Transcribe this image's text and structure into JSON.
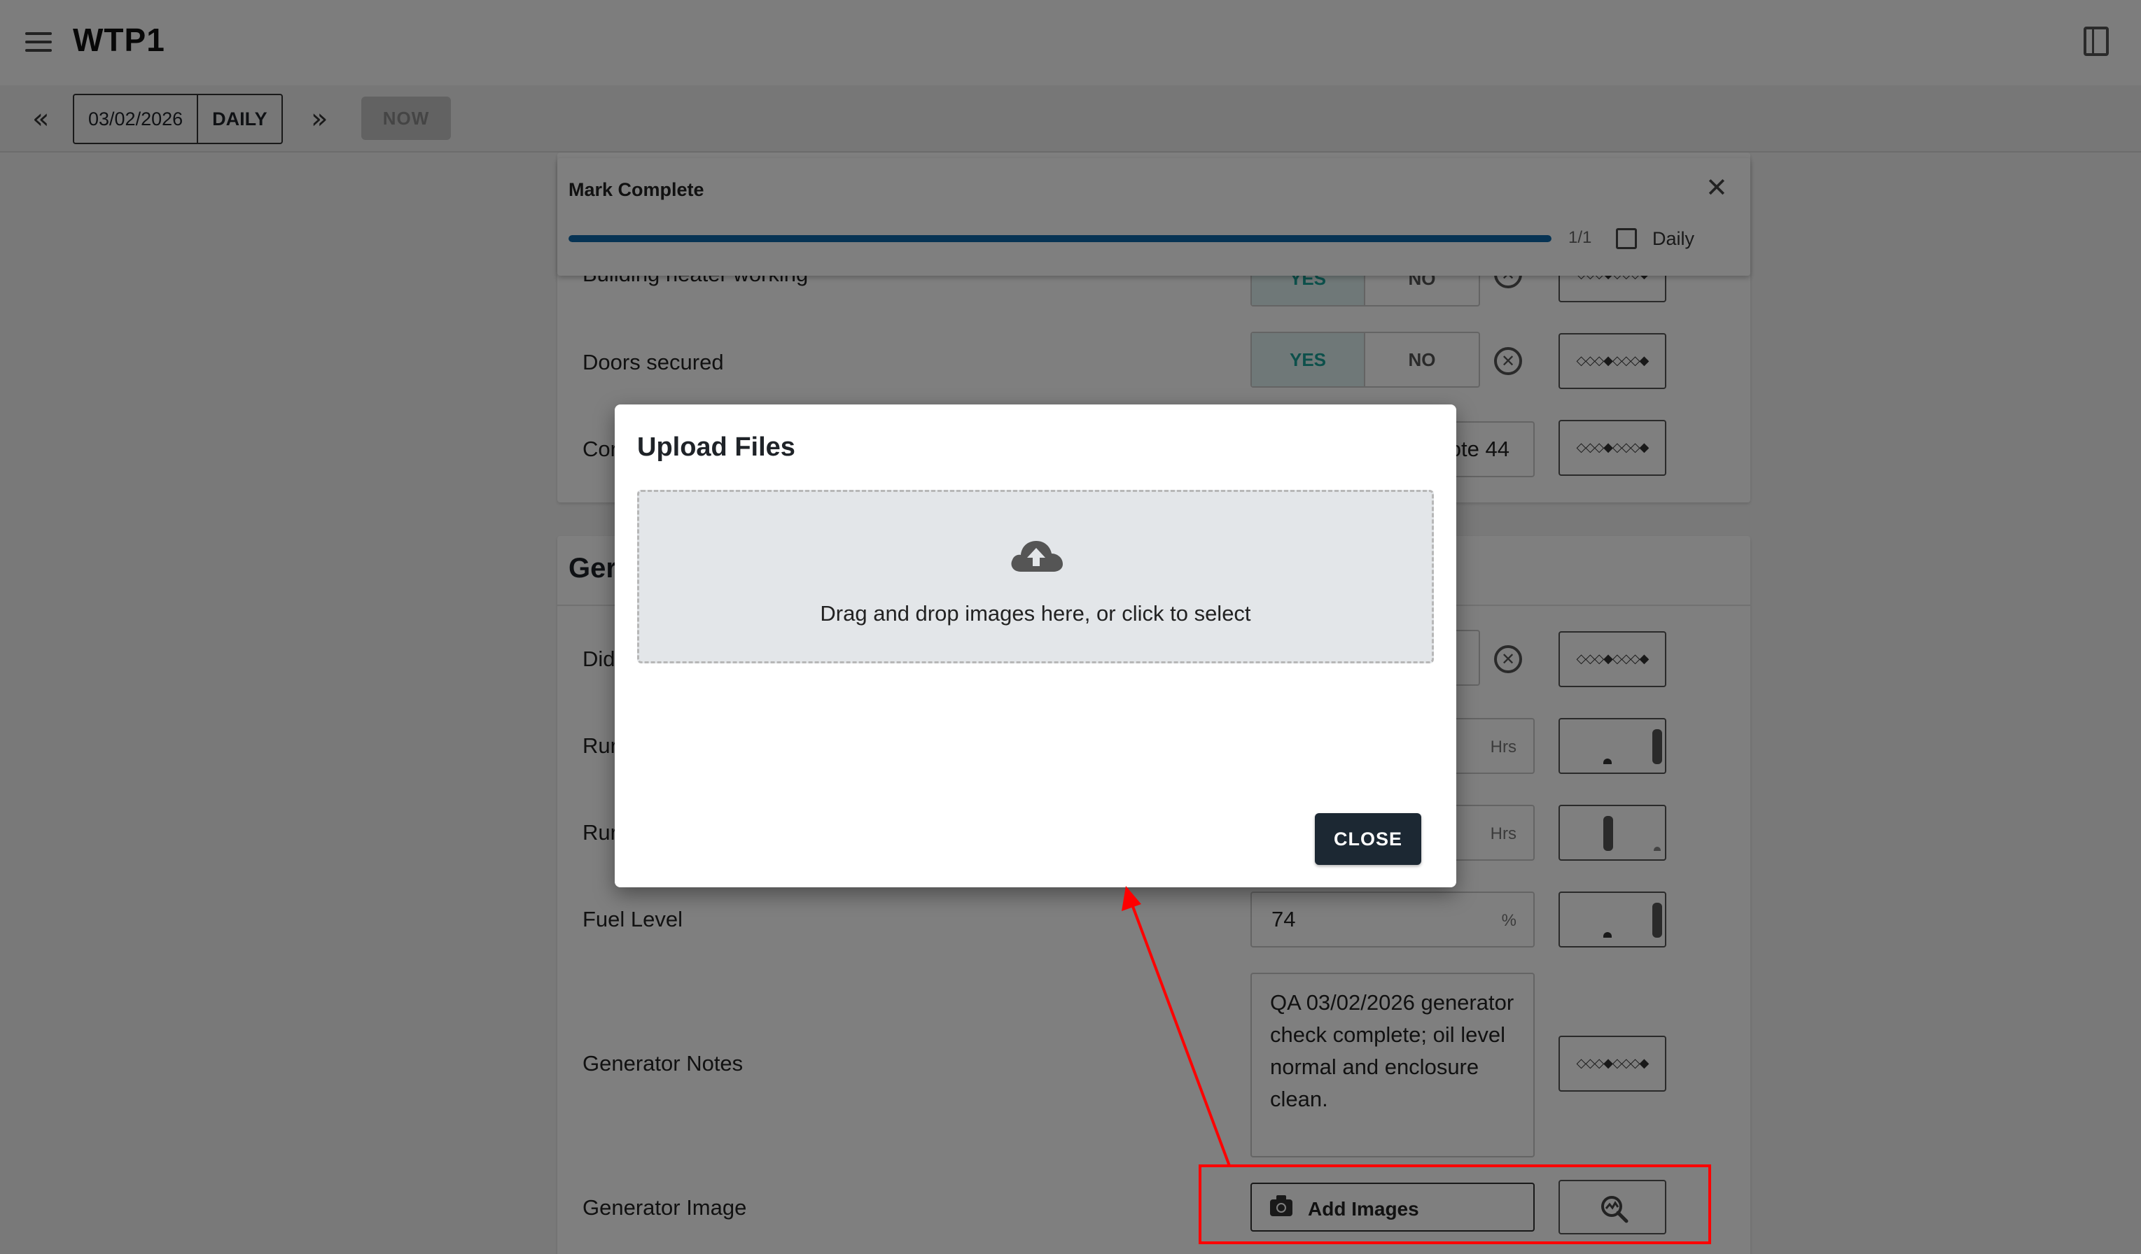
{
  "app": {
    "title": "WTP1"
  },
  "toolbar": {
    "date": "03/02/2026",
    "period": "DAILY",
    "now_label": "NOW",
    "prev_label": "«",
    "next_label": "»"
  },
  "mark_complete": {
    "title": "Mark Complete",
    "progress_text": "1/1",
    "progress_fraction": 1.0,
    "daily_label": "Daily",
    "daily_checked": false
  },
  "rows": {
    "building_heater": "Building heater working",
    "doors_secured": "Doors secured",
    "row_cor": "Cor",
    "cor_value": "ote 44",
    "yes_label": "YES",
    "no_label": "NO",
    "generator_section": "Ger",
    "did": "Did",
    "run1": "Rur",
    "run2": "Rur",
    "hrs_unit": "Hrs",
    "fuel_level": "Fuel Level",
    "fuel_value": "74",
    "fuel_unit": "%",
    "generator_notes": "Generator Notes",
    "notes_value": "QA 03/02/2026 generator check complete; oil level normal and enclosure clean.",
    "generator_image": "Generator Image",
    "add_images_label": "Add Images",
    "diamond_pattern": "◇◇◇◆◇◇◇◆"
  },
  "upload_dialog": {
    "title": "Upload Files",
    "dropzone_text": "Drag and drop images here, or click to select",
    "close_label": "CLOSE"
  },
  "colors": {
    "accent_teal": "#1aa197",
    "progress_blue": "#0d66a8",
    "close_button": "#1c2833",
    "annotation_red": "#ff0000"
  }
}
